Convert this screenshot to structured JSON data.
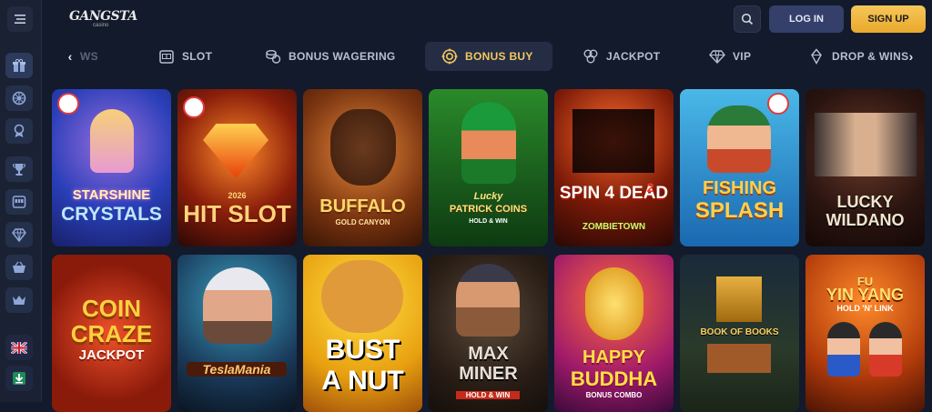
{
  "brand": {
    "name": "GANGSTA",
    "sub": "casino"
  },
  "header": {
    "login": "LOG IN",
    "signup": "SIGN UP"
  },
  "categories": [
    {
      "label": "WS",
      "icon": "star-icon"
    },
    {
      "label": "SLOT",
      "icon": "slot-machine-icon"
    },
    {
      "label": "BONUS WAGERING",
      "icon": "coins-icon"
    },
    {
      "label": "BONUS BUY",
      "icon": "target-coin-icon"
    },
    {
      "label": "JACKPOT",
      "icon": "chips-icon"
    },
    {
      "label": "VIP",
      "icon": "diamond-icon"
    },
    {
      "label": "DROP & WINS",
      "icon": "drop-icon"
    }
  ],
  "games": [
    {
      "t1": "STARSHINE",
      "t2": "CRYSTALS",
      "t3": ""
    },
    {
      "t1": "2026",
      "t2": "HIT SLOT",
      "t3": ""
    },
    {
      "t1": "BUFFALO",
      "t2": "GOLD CANYON",
      "t3": ""
    },
    {
      "t1": "Lucky",
      "t2": "PATRICK COINS",
      "t3": "HOLD & WIN"
    },
    {
      "t1": "SPIN 4 DEAD",
      "t2": "2",
      "t3": "ZOMBIETOWN"
    },
    {
      "t1": "FISHING",
      "t2": "SPLASH",
      "t3": ""
    },
    {
      "t1": "LUCKY",
      "t2": "WILDANO",
      "t3": ""
    },
    {
      "t1": "COIN",
      "t2": "CRAZE",
      "t3": "JACKPOT"
    },
    {
      "t1": "",
      "t2": "TeslaMania",
      "t3": ""
    },
    {
      "t1": "BUST",
      "t2": "A NUT",
      "t3": ""
    },
    {
      "t1": "MAX",
      "t2": "MINER",
      "t3": "HOLD & WIN"
    },
    {
      "t1": "HAPPY",
      "t2": "BUDDHA",
      "t3": "BONUS COMBO"
    },
    {
      "t1": "",
      "t2": "BOOK OF BOOKS",
      "t3": ""
    },
    {
      "t1": "FU",
      "t2": "YIN YANG",
      "t3": "HOLD 'N' LINK"
    }
  ]
}
